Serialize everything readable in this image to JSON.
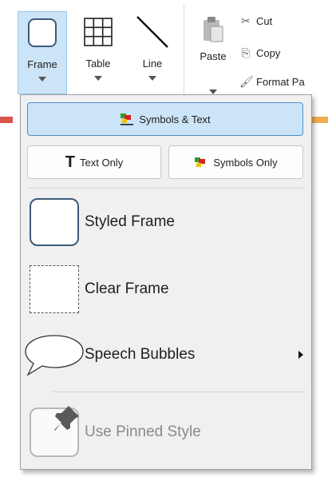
{
  "ribbon": {
    "frame": {
      "label": "Frame",
      "icon": "rounded-rectangle-icon"
    },
    "table": {
      "label": "Table",
      "icon": "table-grid-icon"
    },
    "line": {
      "label": "Line",
      "icon": "diagonal-line-icon"
    },
    "paste": {
      "label": "Paste",
      "icon": "clipboard-icon"
    },
    "cut": {
      "label": "Cut",
      "icon": "scissors-icon"
    },
    "copy": {
      "label": "Copy",
      "icon": "copy-icon"
    },
    "format_painter": {
      "label": "Format Pa",
      "icon": "paintbrush-icon"
    }
  },
  "menu": {
    "symbols_text": {
      "label": "Symbols & Text",
      "icon": "symbols-text-icon"
    },
    "text_only": {
      "label": "Text Only",
      "glyph": "T",
      "icon": "text-t-icon"
    },
    "symbols_only": {
      "label": "Symbols Only",
      "icon": "symbols-icon"
    },
    "items": [
      {
        "label": "Styled Frame",
        "icon": "styled-frame-icon"
      },
      {
        "label": "Clear Frame",
        "icon": "clear-frame-icon"
      },
      {
        "label": "Speech Bubbles",
        "icon": "speech-bubble-icon",
        "has_submenu": true
      },
      {
        "label": "Use Pinned Style",
        "icon": "pin-icon",
        "disabled": true
      }
    ]
  },
  "colors": {
    "selected_bg": "#cce4f7",
    "selected_border": "#4d8fc9",
    "menu_bg": "#f0f0f0",
    "symbol_red": "#e02020",
    "symbol_yellow": "#f2c200",
    "symbol_green": "#2ca02c",
    "accent_red": "#d9534f",
    "accent_orange": "#f0ad4e"
  }
}
